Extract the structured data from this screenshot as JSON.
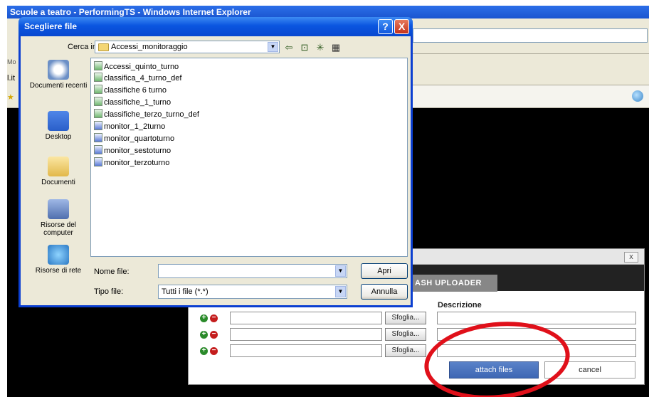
{
  "ie": {
    "title": "Scuole a teatro - PerformingTS - Windows Internet Explorer",
    "left_fragments": [
      "Mo",
      "l.it"
    ]
  },
  "file_dialog": {
    "title": "Scegliere file",
    "help_label": "?",
    "close_label": "X",
    "look_in_label": "Cerca in:",
    "look_in_value": "Accessi_monitoraggio",
    "places": [
      {
        "label": "Documenti recenti",
        "icon": "recent-documents-icon"
      },
      {
        "label": "Desktop",
        "icon": "desktop-icon"
      },
      {
        "label": "Documenti",
        "icon": "my-documents-icon"
      },
      {
        "label": "Risorse del computer",
        "icon": "my-computer-icon"
      },
      {
        "label": "Risorse di rete",
        "icon": "network-places-icon"
      }
    ],
    "files": [
      {
        "name": "Accessi_quinto_turno",
        "type": "xls"
      },
      {
        "name": "classifica_4_turno_def",
        "type": "xls"
      },
      {
        "name": "classifiche 6 turno",
        "type": "xls"
      },
      {
        "name": "classifiche_1_turno",
        "type": "xls"
      },
      {
        "name": "classifiche_terzo_turno_def",
        "type": "xls"
      },
      {
        "name": "monitor_1_2turno",
        "type": "doc"
      },
      {
        "name": "monitor_quartoturno",
        "type": "doc"
      },
      {
        "name": "monitor_sestoturno",
        "type": "doc"
      },
      {
        "name": "monitor_terzoturno",
        "type": "doc"
      }
    ],
    "file_name_label": "Nome file:",
    "file_name_value": "",
    "file_type_label": "Tipo file:",
    "file_type_value": "Tutti i file (*.*)",
    "open_button": "Apri",
    "cancel_button": "Annulla"
  },
  "uploader": {
    "close_label": "x",
    "tab_label": "ASH UPLOADER",
    "description_header": "Descrizione",
    "browse_label": "Sfoglia...",
    "rows": 3,
    "attach_button": "attach files",
    "cancel_button": "cancel"
  },
  "colors": {
    "annotation_ring": "#e0101a",
    "xp_title_blue": "#0a55e0",
    "attach_button_blue": "#4a72bc"
  }
}
